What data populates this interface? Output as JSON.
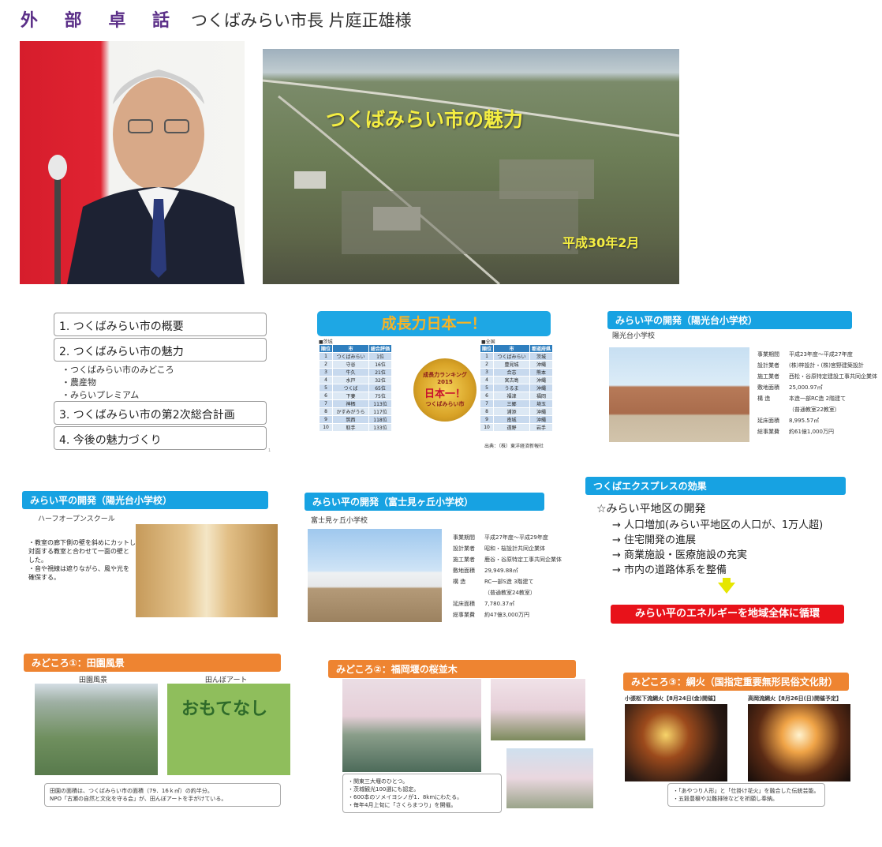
{
  "header": {
    "prefix": "外 部 卓 話",
    "title": "つくばみらい市長 片庭正雄様"
  },
  "hero": {
    "title": "つくばみらい市の魅力",
    "date": "平成30年2月"
  },
  "agenda": {
    "items": [
      "1. つくばみらい市の概要",
      "2. つくばみらい市の魅力",
      "3. つくばみらい市の第2次総合計画",
      "4. 今後の魅力づくり"
    ],
    "subitems": [
      "・つくばみらい市のみどころ",
      "・農産物",
      "・みらいプレミアム"
    ],
    "page": "1"
  },
  "ranking": {
    "title": "成長力日本一！",
    "left_label": "■茨城",
    "right_label": "■全国",
    "left_headers": [
      "順位",
      "市",
      "総合評価"
    ],
    "right_headers": [
      "順位",
      "市",
      "都道府県"
    ],
    "left_rows": [
      [
        "1",
        "つくばみらい",
        "1位"
      ],
      [
        "2",
        "守谷",
        "16位"
      ],
      [
        "3",
        "牛久",
        "21位"
      ],
      [
        "4",
        "水戸",
        "32位"
      ],
      [
        "5",
        "つくば",
        "65位"
      ],
      [
        "6",
        "下妻",
        "75位"
      ],
      [
        "7",
        "神栖",
        "113位"
      ],
      [
        "8",
        "かすみがうら",
        "117位"
      ],
      [
        "9",
        "筑西",
        "118位"
      ],
      [
        "10",
        "取手",
        "133位"
      ]
    ],
    "right_rows": [
      [
        "1",
        "つくばみらい",
        "茨城"
      ],
      [
        "2",
        "豊見城",
        "沖縄"
      ],
      [
        "3",
        "合志",
        "熊本"
      ],
      [
        "4",
        "宮古島",
        "沖縄"
      ],
      [
        "5",
        "うるま",
        "沖縄"
      ],
      [
        "6",
        "福津",
        "福岡"
      ],
      [
        "7",
        "三郷",
        "埼玉"
      ],
      [
        "8",
        "浦添",
        "沖縄"
      ],
      [
        "9",
        "南城",
        "沖縄"
      ],
      [
        "10",
        "遠野",
        "岩手"
      ]
    ],
    "badge_top": "成長力ランキング",
    "badge_year": "2015",
    "badge_main": "日本一！",
    "badge_bottom": "つくばみらい市",
    "source": "出典：（株）東洋経済新報社"
  },
  "school1": {
    "bar": "みらい平の開発（陽光台小学校）",
    "name": "陽光台小学校",
    "specs": [
      [
        "事業期間",
        "平成23年度～平成27年度"
      ],
      [
        "設計業者",
        "(株)梓設計・(株)宮野建築設計"
      ],
      [
        "施工業者",
        "西松・谷原特定建設工事共同企業体"
      ],
      [
        "敷地面積",
        "25,000.97㎡"
      ],
      [
        "構 造",
        "本造一部RC造 2階建て"
      ],
      [
        "",
        "（普通教室22教室）"
      ],
      [
        "延床面積",
        "8,995.57㎡"
      ],
      [
        "総事業費",
        "約61億1,000万円"
      ]
    ]
  },
  "school2": {
    "bar": "みらい平の開発（陽光台小学校）",
    "sub": "ハーフオープンスクール",
    "notes": [
      "・教室の廊下側の壁を斜めにカットし",
      "対面する教室と合わせて一面の壁と",
      "した。",
      "・音や視線は遮りながら、風や光を",
      "確保する。"
    ]
  },
  "school3": {
    "bar": "みらい平の開発（富士見ヶ丘小学校）",
    "name": "富士見ヶ丘小学校",
    "specs": [
      [
        "事業期間",
        "平成27年度～平成29年度"
      ],
      [
        "設計業者",
        "昭和・桜設計共同企業体"
      ],
      [
        "施工業者",
        "鹿谷・谷原特定工事共同企業体"
      ],
      [
        "敷地面積",
        "29,949.88㎡"
      ],
      [
        "構 造",
        "RC一部S造 3階建て"
      ],
      [
        "",
        "（普通教室24教室）"
      ],
      [
        "延床面積",
        "7,780.37㎡"
      ],
      [
        "総事業費",
        "約47億3,000万円"
      ]
    ]
  },
  "express": {
    "bar": "つくばエクスプレスの効果",
    "head": "☆みらい平地区の開発",
    "items": [
      "→ 人口増加(みらい平地区の人口が、1万人超)",
      "→ 住宅開発の進展",
      "→ 商業施設・医療施設の充実",
      "→ 市内の道路体系を整備"
    ],
    "result": "みらい平のエネルギーを地域全体に循環"
  },
  "spot1": {
    "bar": "みどころ①：田園風景",
    "cap1": "田園風景",
    "cap2": "田んぼアート",
    "art_text": "おもてなし",
    "note": [
      "田園の面積は、つくばみらい市の面積（79．16ｋ㎡）の約半分。",
      "NPO「古瀬の自然と文化を守る会」が、田んぼアートを手がけている。"
    ]
  },
  "spot2": {
    "bar": "みどころ②：福岡堰の桜並木",
    "note": [
      "・関東三大堰のひとつ。",
      "・茨城観光100選にも認定。",
      "・600本のソメイヨシノが1．8kmにわたる。",
      "・毎年4月上旬に「さくらまつり」を開催。"
    ]
  },
  "spot3": {
    "bar": "みどころ③：綱火（国指定重要無形民俗文化財）",
    "cap1": "小張松下流綱火【8月24日(金)開催】",
    "cap2": "高岡流綱火【8月26日(日)開催予定】",
    "note": [
      "・「あやつり人形」と「仕掛け花火」を融合した伝統芸能。",
      "・五穀豊穣や災難排除などを祈願し奉納。"
    ]
  },
  "colors": {
    "title_purple": "#5b2f88",
    "slide_blue": "#17a2e2",
    "slide_orange": "#ee8431",
    "alert_red": "#e8121a",
    "hero_yellow": "#f4ee42"
  }
}
